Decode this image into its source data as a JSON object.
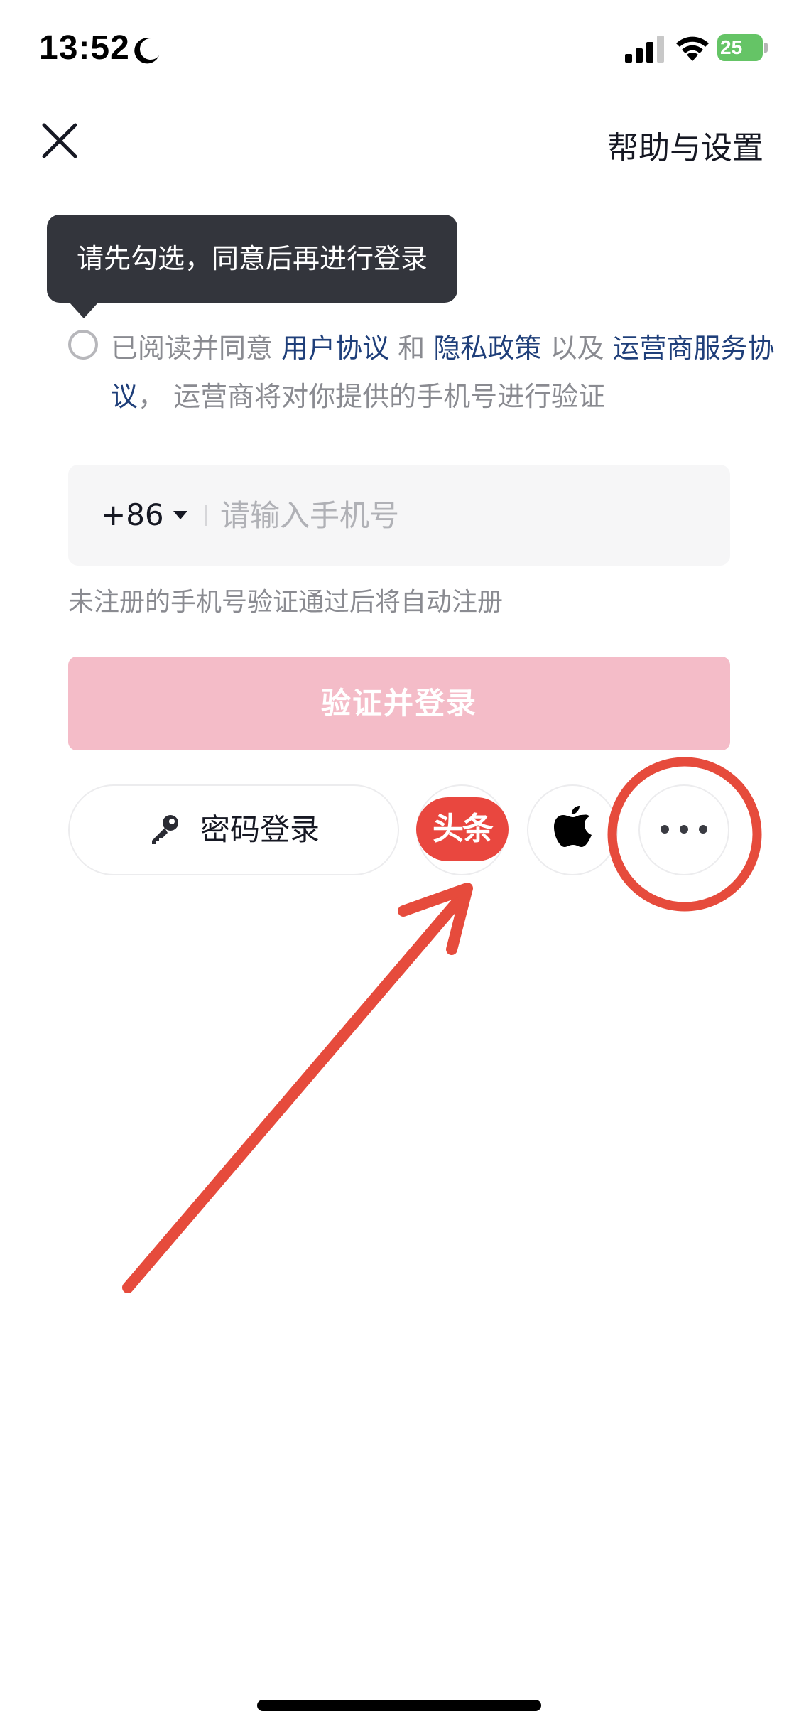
{
  "status_bar": {
    "time": "13:52",
    "battery_level": "25",
    "icons": [
      "moon-icon",
      "signal-icon",
      "wifi-icon",
      "battery-icon"
    ],
    "battery_color": "#65c466"
  },
  "header": {
    "close_icon": "close-icon",
    "help_settings_label": "帮助与设置"
  },
  "tooltip": {
    "text": "请先勾选，同意后再进行登录"
  },
  "agreement": {
    "prefix": "已阅读并同意",
    "user_agreement": "用户协议",
    "and": "和",
    "privacy_policy": "隐私政策",
    "as_well_as": "以及",
    "carrier_agreement": "运营商服务协议",
    "comma": "，",
    "suffix": "运营商将对你提供的手机号进行验证",
    "link_color": "#1f3f7a"
  },
  "phone": {
    "country_code": "+86",
    "placeholder": "请输入手机号",
    "value": ""
  },
  "auto_register_note": "未注册的手机号验证通过后将自动注册",
  "login_button": {
    "label": "验证并登录",
    "color": "#f4bcc8"
  },
  "other_login": {
    "password_label": "密码登录",
    "toutiao_label": "头条",
    "toutiao_color": "#e9473f",
    "icons": [
      "key-icon",
      "apple-icon",
      "more-icon"
    ]
  },
  "annotation": {
    "color": "#e64b3c",
    "marks": [
      "annotation-arrow",
      "annotation-circle"
    ]
  }
}
